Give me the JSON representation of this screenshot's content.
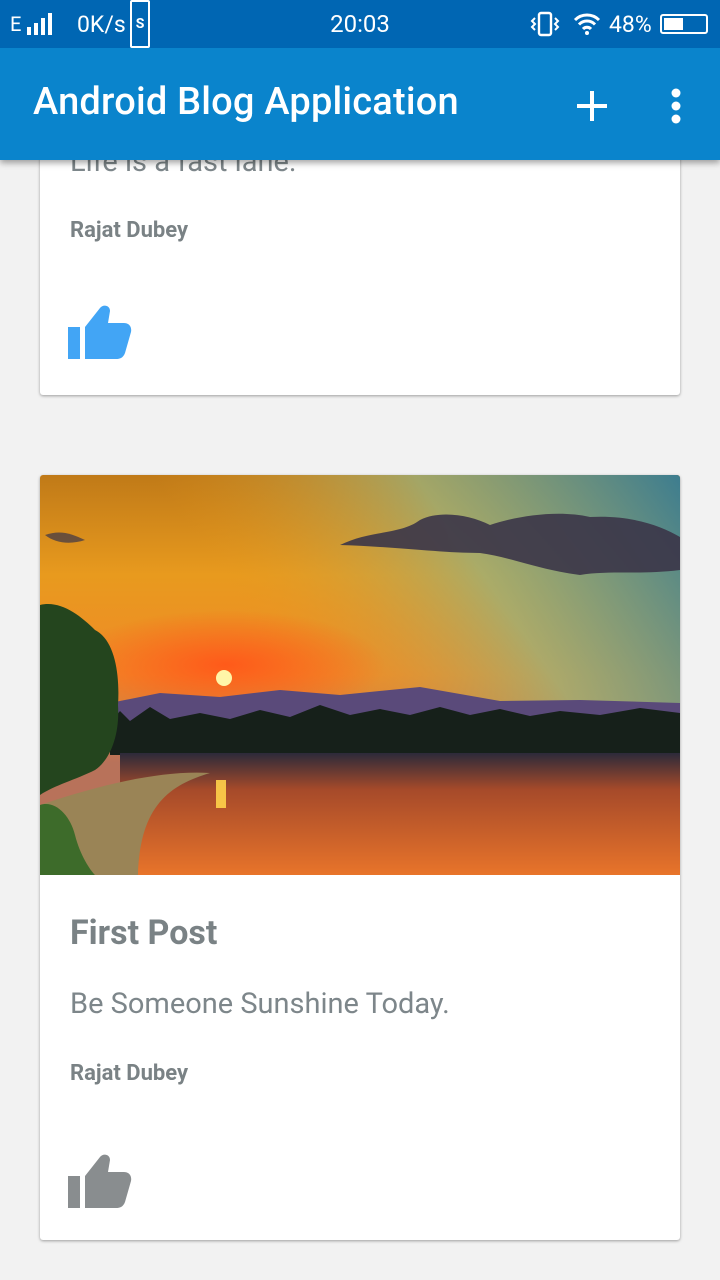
{
  "status_bar": {
    "network_type": "E",
    "data_speed": "0K/s",
    "s_icon_label": "S",
    "time": "20:03",
    "battery_percent": "48%",
    "battery_level": 0.48
  },
  "app_bar": {
    "title": "Android Blog Application",
    "add_icon": "plus-icon",
    "menu_icon": "more-vert-icon"
  },
  "posts": [
    {
      "title": "",
      "description": "Life is a fast lane.",
      "author": "Rajat Dubey",
      "liked": true,
      "like_color": "#42a5f5"
    },
    {
      "title": "First Post",
      "description": "Be Someone Sunshine Today.",
      "author": "Rajat Dubey",
      "liked": false,
      "like_color": "#898d8f"
    }
  ],
  "colors": {
    "status_bar": "#0066b3",
    "app_bar": "#0a84cc",
    "like_active": "#42a5f5",
    "like_inactive": "#898d8f",
    "text_secondary": "#7a8285"
  }
}
